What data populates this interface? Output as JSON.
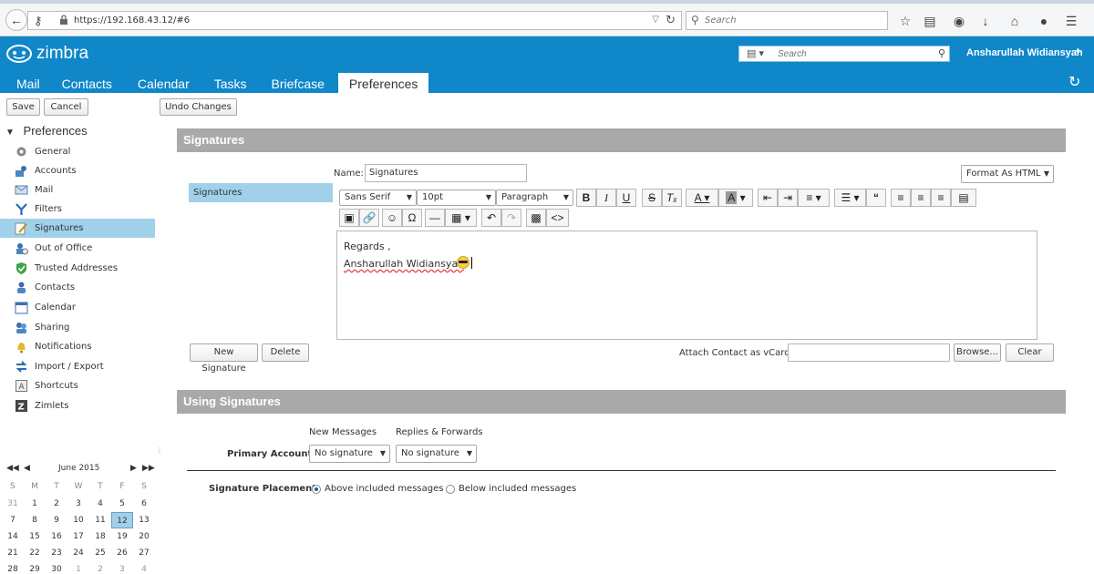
{
  "browser": {
    "url": "https://192.168.43.12/#6",
    "search_placeholder": "Search"
  },
  "header": {
    "logo_text": "zimbra",
    "search_placeholder": "Search",
    "username": "Ansharullah Widiansyah"
  },
  "tabs": [
    {
      "label": "Mail"
    },
    {
      "label": "Contacts"
    },
    {
      "label": "Calendar"
    },
    {
      "label": "Tasks"
    },
    {
      "label": "Briefcase"
    },
    {
      "label": "Preferences"
    }
  ],
  "toolbar": {
    "save_label": "Save",
    "cancel_label": "Cancel",
    "undo_label": "Undo Changes"
  },
  "sidebar": {
    "title": "Preferences",
    "items": [
      {
        "label": "General"
      },
      {
        "label": "Accounts"
      },
      {
        "label": "Mail"
      },
      {
        "label": "Filters"
      },
      {
        "label": "Signatures"
      },
      {
        "label": "Out of Office"
      },
      {
        "label": "Trusted Addresses"
      },
      {
        "label": "Contacts"
      },
      {
        "label": "Calendar"
      },
      {
        "label": "Sharing"
      },
      {
        "label": "Notifications"
      },
      {
        "label": "Import / Export"
      },
      {
        "label": "Shortcuts"
      },
      {
        "label": "Zimlets"
      }
    ]
  },
  "calendar": {
    "month_label": "June 2015",
    "days_of_week": [
      "S",
      "M",
      "T",
      "W",
      "T",
      "F",
      "S"
    ],
    "weeks": [
      [
        "31",
        "1",
        "2",
        "3",
        "4",
        "5",
        "6"
      ],
      [
        "7",
        "8",
        "9",
        "10",
        "11",
        "12",
        "13"
      ],
      [
        "14",
        "15",
        "16",
        "17",
        "18",
        "19",
        "20"
      ],
      [
        "21",
        "22",
        "23",
        "24",
        "25",
        "26",
        "27"
      ],
      [
        "28",
        "29",
        "30",
        "1",
        "2",
        "3",
        "4"
      ]
    ]
  },
  "signatures": {
    "section_title": "Signatures",
    "name_label": "Name:",
    "name_value": "Signatures",
    "format_label": "Format As HTML",
    "list": [
      "Signatures"
    ],
    "font_family": "Sans Serif",
    "font_size": "10pt",
    "block_format": "Paragraph",
    "body_line1": "Regards ,",
    "body_line2": "Ansharullah Widiansyah",
    "new_button": "New Signature",
    "delete_button": "Delete",
    "vcard_label": "Attach Contact as vCard:",
    "browse_button": "Browse...",
    "clear_button": "Clear"
  },
  "using": {
    "section_title": "Using Signatures",
    "col_new": "New Messages",
    "col_replies": "Replies & Forwards",
    "primary_label": "Primary Account:",
    "new_value": "No signature",
    "replies_value": "No signature",
    "placement_label": "Signature Placement:",
    "above_label": "Above included messages",
    "below_label": "Below included messages"
  },
  "colors": {
    "brand": "#0f87c9",
    "selection": "#a1d1ea",
    "section": "#a9a9a9"
  }
}
